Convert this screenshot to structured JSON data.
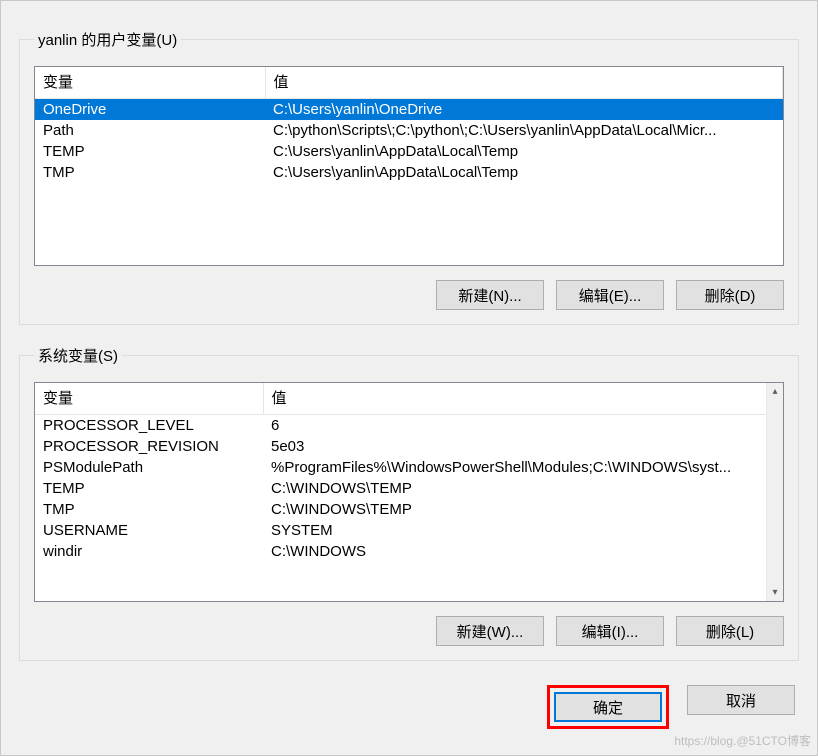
{
  "user_section": {
    "legend": "yanlin 的用户变量(U)",
    "headers": {
      "var": "变量",
      "val": "值"
    },
    "rows": [
      {
        "var": "OneDrive",
        "val": "C:\\Users\\yanlin\\OneDrive",
        "selected": true
      },
      {
        "var": "Path",
        "val": "C:\\python\\Scripts\\;C:\\python\\;C:\\Users\\yanlin\\AppData\\Local\\Micr..."
      },
      {
        "var": "TEMP",
        "val": "C:\\Users\\yanlin\\AppData\\Local\\Temp"
      },
      {
        "var": "TMP",
        "val": "C:\\Users\\yanlin\\AppData\\Local\\Temp"
      }
    ],
    "buttons": {
      "new": "新建(N)...",
      "edit": "编辑(E)...",
      "delete": "删除(D)"
    }
  },
  "system_section": {
    "legend": "系统变量(S)",
    "headers": {
      "var": "变量",
      "val": "值"
    },
    "rows": [
      {
        "var": "PROCESSOR_LEVEL",
        "val": "6"
      },
      {
        "var": "PROCESSOR_REVISION",
        "val": "5e03"
      },
      {
        "var": "PSModulePath",
        "val": "%ProgramFiles%\\WindowsPowerShell\\Modules;C:\\WINDOWS\\syst..."
      },
      {
        "var": "TEMP",
        "val": "C:\\WINDOWS\\TEMP"
      },
      {
        "var": "TMP",
        "val": "C:\\WINDOWS\\TEMP"
      },
      {
        "var": "USERNAME",
        "val": "SYSTEM"
      },
      {
        "var": "windir",
        "val": "C:\\WINDOWS"
      }
    ],
    "buttons": {
      "new": "新建(W)...",
      "edit": "编辑(I)...",
      "delete": "删除(L)"
    }
  },
  "dialog_buttons": {
    "ok": "确定",
    "cancel": "取消"
  },
  "scroll_glyphs": {
    "up": "▴",
    "down": "▾"
  },
  "watermark": "https://blog.@51CTO博客"
}
